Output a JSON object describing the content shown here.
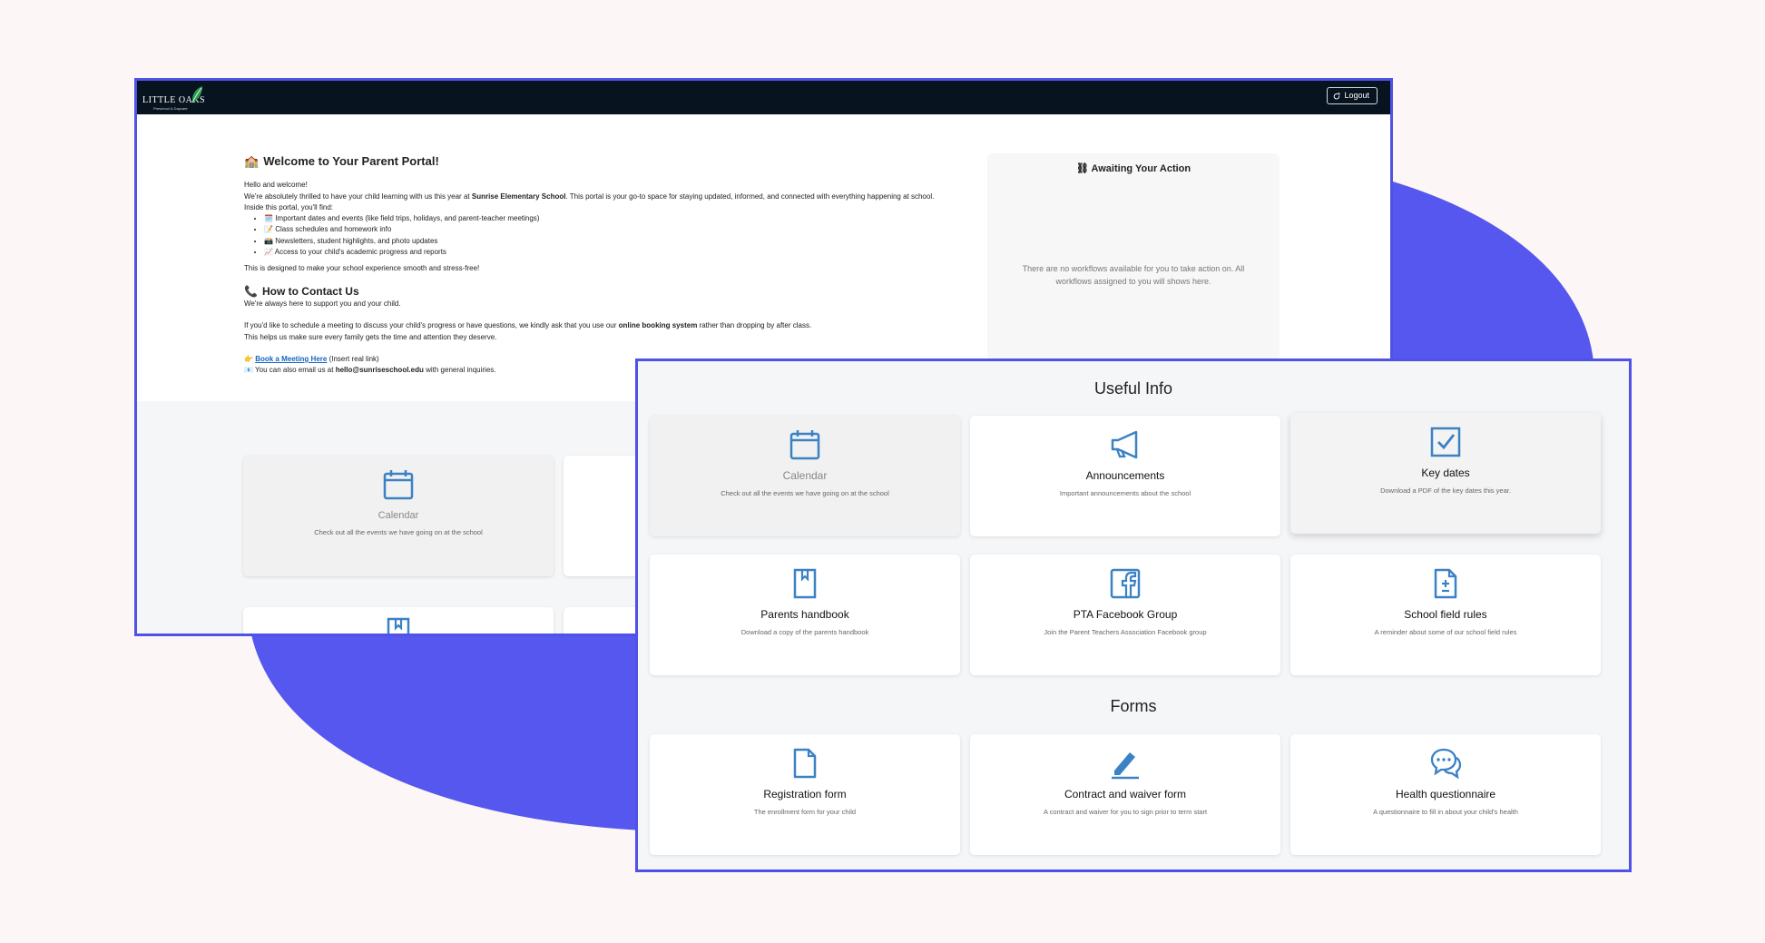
{
  "colors": {
    "accent": "#5557ee",
    "icon": "#3b82c4",
    "topbar": "#07131f"
  },
  "header": {
    "logo_name": "LITTLE OAKS",
    "logo_tagline": "Preschool & Daycare",
    "logout_label": "Logout"
  },
  "welcome": {
    "title": "Welcome to Your Parent Portal!",
    "greeting": "Hello and welcome!",
    "intro_before": "We're absolutely thrilled to have your child learning with us this year at",
    "school": "Sunrise Elementary School",
    "intro_after": ". This portal is your go-to space for staying updated, informed, and connected with everything happening at school.",
    "inside": "Inside this portal, you'll find:",
    "items": [
      "Important dates and events (like field trips, holidays, and parent-teacher meetings)",
      "Class schedules and homework info",
      "Newsletters, student highlights, and photo updates",
      "Access to your child's academic progress and reports"
    ],
    "closing": "This is designed to make your school experience smooth and stress-free!"
  },
  "contact": {
    "title": "How to Contact Us",
    "support": "We're always here to support you and your child.",
    "schedule_before": "If you'd like to schedule a meeting to discuss your child's progress or have questions, we kindly ask that you use our",
    "booking": "online booking system",
    "schedule_after": "rather than dropping by after class.",
    "helps": "This helps us make sure every family gets the time and attention they deserve.",
    "book_link": "Book a Meeting Here",
    "book_note": "(Insert real link)",
    "email_before": "You can also email us at",
    "email": "hello@sunriseschool.edu",
    "email_after": "with general inquiries."
  },
  "awaiting": {
    "title": "Awaiting Your Action",
    "empty": "There are no workflows available for you to take action on. All workflows assigned to you will shows here."
  },
  "useful_info": {
    "title": "Useful Info",
    "cards": [
      {
        "title": "Calendar",
        "desc": "Check out all the events we have going on at the school",
        "icon": "calendar-icon"
      },
      {
        "title": "Announcements",
        "desc": "Important announcements about the school",
        "icon": "megaphone-icon"
      },
      {
        "title": "Key dates",
        "desc": "Download a PDF of the key dates this year.",
        "icon": "checkbox-icon"
      },
      {
        "title": "Parents handbook",
        "desc": "Download a copy of the parents handbook",
        "icon": "bookmark-book-icon"
      },
      {
        "title": "PTA Facebook Group",
        "desc": "Join the Parent Teachers Association Facebook group",
        "icon": "facebook-icon"
      },
      {
        "title": "School field rules",
        "desc": "A reminder about some of our school field rules",
        "icon": "document-plus-minus-icon"
      }
    ]
  },
  "forms": {
    "title": "Forms",
    "cards": [
      {
        "title": "Registration form",
        "desc": "The enrollment form for your child",
        "icon": "file-icon"
      },
      {
        "title": "Contract and waiver form",
        "desc": "A contract and waiver for you to sign prior to term start",
        "icon": "pen-icon"
      },
      {
        "title": "Health questionnaire",
        "desc": "A questionnaire to fill in about your child's health",
        "icon": "chat-bubbles-icon"
      }
    ]
  }
}
